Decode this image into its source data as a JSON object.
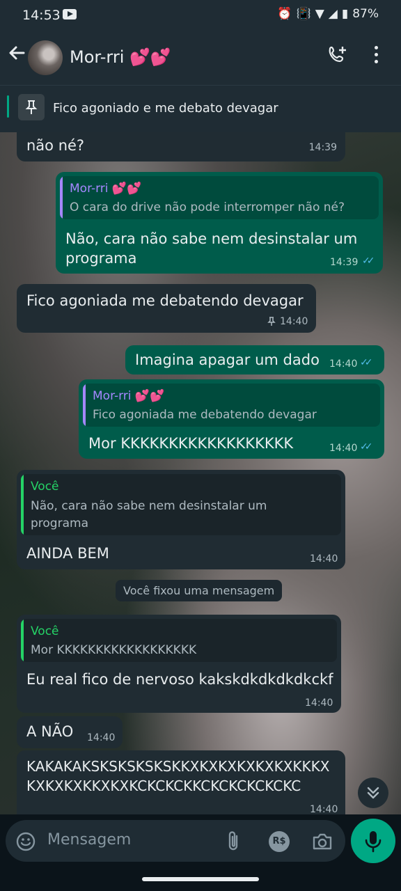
{
  "status_bar": {
    "time": "14:53",
    "battery": "87%",
    "icons": "⏰ 📳 Vo LTE ▼ ◢ ▮"
  },
  "header": {
    "contact_name": "Mor-rri 💕💕",
    "pinned_message": "Fico agoniado e me debato devagar"
  },
  "messages": [
    {
      "dir": "in",
      "text": "não né?",
      "time": "14:39"
    },
    {
      "dir": "out",
      "quote_name": "Mor-rri 💕💕",
      "quote_text": "O cara do drive não pode interromper não né?",
      "text_lines": [
        "Não, cara não sabe nem desinstalar um",
        "programa"
      ],
      "time": "14:39"
    },
    {
      "dir": "in",
      "text": "Fico agoniada me debatendo devagar",
      "time": "14:40",
      "pinned": true
    },
    {
      "dir": "out",
      "text": "Imagina apagar um dado",
      "time": "14:40"
    },
    {
      "dir": "out",
      "quote_name": "Mor-rri 💕💕",
      "quote_text": "Fico agoniada me debatendo devagar",
      "text": "Mor KKKKKKKKKKKKKKKKKK",
      "time": "14:40"
    },
    {
      "dir": "in",
      "quote_name": "Você",
      "quote_lines": [
        "Não, cara não sabe nem desinstalar um",
        "programa"
      ],
      "text": "AINDA BEM",
      "time": "14:40"
    },
    {
      "dir": "in",
      "quote_name": "Você",
      "quote_text": "Mor KKKKKKKKKKKKKKKKKK",
      "text": "Eu real fico de nervoso kakskdkdkdkdkckf",
      "time": "14:40"
    },
    {
      "dir": "in",
      "text": "A NÃO",
      "time": "14:40"
    },
    {
      "dir": "in",
      "text_lines": [
        "KAKAKAKSKSKSKSKSKKXKXKXKXKXKXKKKX",
        "KXKXKXKKXKXKCKCKCKKCKCKCKCKCKC"
      ],
      "time": "14:40"
    }
  ],
  "system_message": "Você fixou uma mensagem",
  "input": {
    "placeholder": "Mensagem",
    "currency_label": "R$"
  },
  "colors": {
    "accent": "#00a884",
    "outgoing": "#005c4b",
    "incoming": "#202c33",
    "read_ticks": "#53bdeb",
    "quote_contact": "#a587ff",
    "quote_self": "#25d366"
  }
}
